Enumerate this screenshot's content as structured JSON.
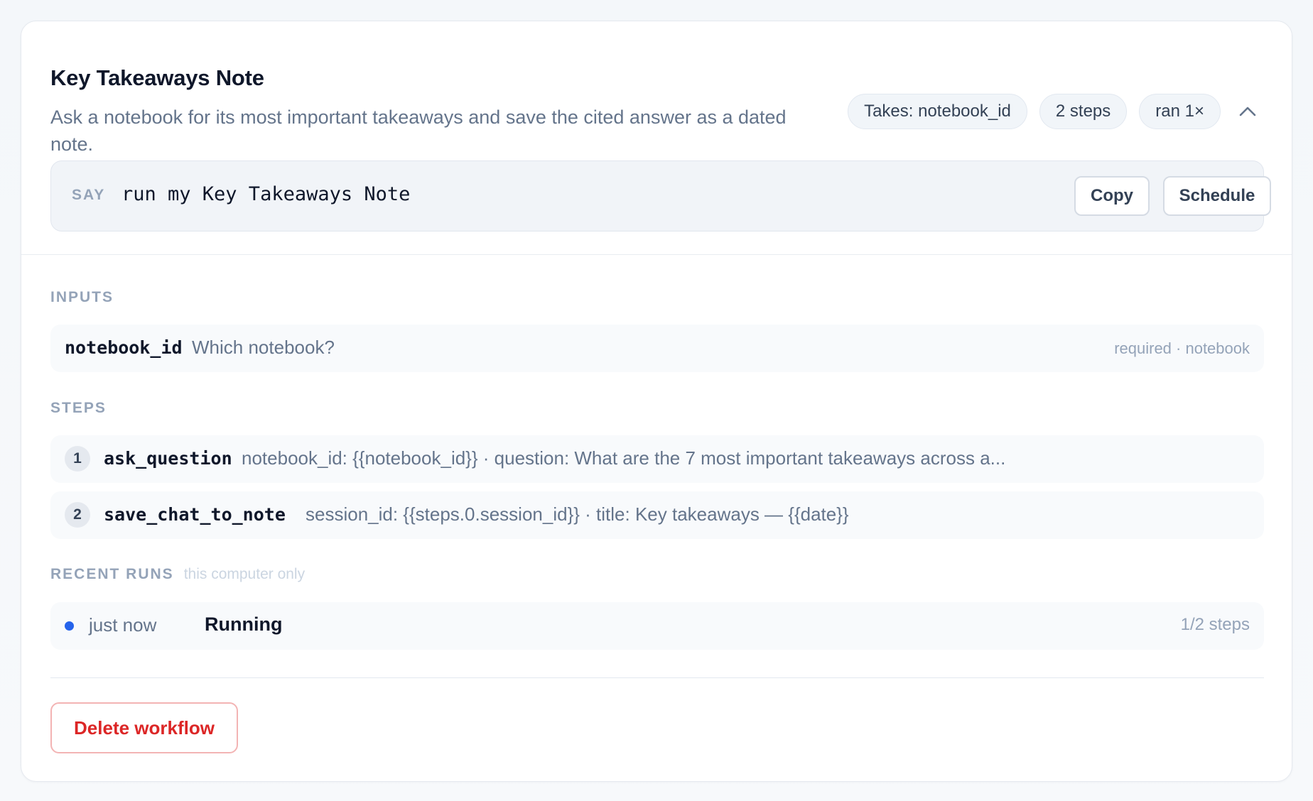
{
  "workflow": {
    "title": "Key Takeaways Note",
    "description": "Ask a notebook for its most important takeaways and save the cited answer as a dated note.",
    "chips": [
      "Takes: notebook_id",
      "2 steps",
      "ran 1×"
    ],
    "collapse_icon": "chevron-up-icon"
  },
  "say": {
    "label": "SAY",
    "command": "run my Key Takeaways Note",
    "copy_label": "Copy",
    "schedule_label": "Schedule"
  },
  "inputs": {
    "label": "INPUTS",
    "items": [
      {
        "name": "notebook_id",
        "prompt": "Which notebook?",
        "meta": "required · notebook"
      }
    ]
  },
  "steps": {
    "label": "STEPS",
    "items": [
      {
        "num": "1",
        "name": "ask_question",
        "args": "notebook_id: {{notebook_id}} · question: What are the 7 most important takeaways across a..."
      },
      {
        "num": "2",
        "name": "save_chat_to_note",
        "args": "session_id: {{steps.0.session_id}} · title: Key takeaways — {{date}}"
      }
    ]
  },
  "recent_runs": {
    "label": "RECENT RUNS",
    "note": "this computer only",
    "status_color": "#2563eb",
    "items": [
      {
        "time": "just now",
        "status": "Running",
        "progress": "1/2 steps"
      }
    ]
  },
  "actions": {
    "delete_label": "Delete workflow"
  }
}
